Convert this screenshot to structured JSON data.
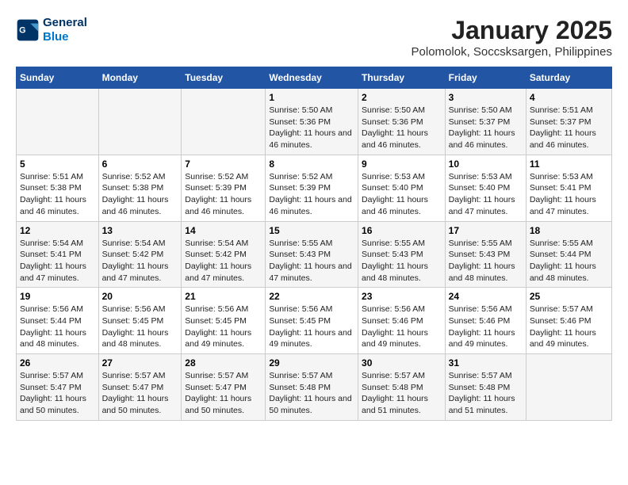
{
  "logo": {
    "line1": "General",
    "line2": "Blue"
  },
  "title": "January 2025",
  "subtitle": "Polomolok, Soccsksargen, Philippines",
  "headers": [
    "Sunday",
    "Monday",
    "Tuesday",
    "Wednesday",
    "Thursday",
    "Friday",
    "Saturday"
  ],
  "weeks": [
    [
      {
        "day": "",
        "sunrise": "",
        "sunset": "",
        "daylight": ""
      },
      {
        "day": "",
        "sunrise": "",
        "sunset": "",
        "daylight": ""
      },
      {
        "day": "",
        "sunrise": "",
        "sunset": "",
        "daylight": ""
      },
      {
        "day": "1",
        "sunrise": "Sunrise: 5:50 AM",
        "sunset": "Sunset: 5:36 PM",
        "daylight": "Daylight: 11 hours and 46 minutes."
      },
      {
        "day": "2",
        "sunrise": "Sunrise: 5:50 AM",
        "sunset": "Sunset: 5:36 PM",
        "daylight": "Daylight: 11 hours and 46 minutes."
      },
      {
        "day": "3",
        "sunrise": "Sunrise: 5:50 AM",
        "sunset": "Sunset: 5:37 PM",
        "daylight": "Daylight: 11 hours and 46 minutes."
      },
      {
        "day": "4",
        "sunrise": "Sunrise: 5:51 AM",
        "sunset": "Sunset: 5:37 PM",
        "daylight": "Daylight: 11 hours and 46 minutes."
      }
    ],
    [
      {
        "day": "5",
        "sunrise": "Sunrise: 5:51 AM",
        "sunset": "Sunset: 5:38 PM",
        "daylight": "Daylight: 11 hours and 46 minutes."
      },
      {
        "day": "6",
        "sunrise": "Sunrise: 5:52 AM",
        "sunset": "Sunset: 5:38 PM",
        "daylight": "Daylight: 11 hours and 46 minutes."
      },
      {
        "day": "7",
        "sunrise": "Sunrise: 5:52 AM",
        "sunset": "Sunset: 5:39 PM",
        "daylight": "Daylight: 11 hours and 46 minutes."
      },
      {
        "day": "8",
        "sunrise": "Sunrise: 5:52 AM",
        "sunset": "Sunset: 5:39 PM",
        "daylight": "Daylight: 11 hours and 46 minutes."
      },
      {
        "day": "9",
        "sunrise": "Sunrise: 5:53 AM",
        "sunset": "Sunset: 5:40 PM",
        "daylight": "Daylight: 11 hours and 46 minutes."
      },
      {
        "day": "10",
        "sunrise": "Sunrise: 5:53 AM",
        "sunset": "Sunset: 5:40 PM",
        "daylight": "Daylight: 11 hours and 47 minutes."
      },
      {
        "day": "11",
        "sunrise": "Sunrise: 5:53 AM",
        "sunset": "Sunset: 5:41 PM",
        "daylight": "Daylight: 11 hours and 47 minutes."
      }
    ],
    [
      {
        "day": "12",
        "sunrise": "Sunrise: 5:54 AM",
        "sunset": "Sunset: 5:41 PM",
        "daylight": "Daylight: 11 hours and 47 minutes."
      },
      {
        "day": "13",
        "sunrise": "Sunrise: 5:54 AM",
        "sunset": "Sunset: 5:42 PM",
        "daylight": "Daylight: 11 hours and 47 minutes."
      },
      {
        "day": "14",
        "sunrise": "Sunrise: 5:54 AM",
        "sunset": "Sunset: 5:42 PM",
        "daylight": "Daylight: 11 hours and 47 minutes."
      },
      {
        "day": "15",
        "sunrise": "Sunrise: 5:55 AM",
        "sunset": "Sunset: 5:43 PM",
        "daylight": "Daylight: 11 hours and 47 minutes."
      },
      {
        "day": "16",
        "sunrise": "Sunrise: 5:55 AM",
        "sunset": "Sunset: 5:43 PM",
        "daylight": "Daylight: 11 hours and 48 minutes."
      },
      {
        "day": "17",
        "sunrise": "Sunrise: 5:55 AM",
        "sunset": "Sunset: 5:43 PM",
        "daylight": "Daylight: 11 hours and 48 minutes."
      },
      {
        "day": "18",
        "sunrise": "Sunrise: 5:55 AM",
        "sunset": "Sunset: 5:44 PM",
        "daylight": "Daylight: 11 hours and 48 minutes."
      }
    ],
    [
      {
        "day": "19",
        "sunrise": "Sunrise: 5:56 AM",
        "sunset": "Sunset: 5:44 PM",
        "daylight": "Daylight: 11 hours and 48 minutes."
      },
      {
        "day": "20",
        "sunrise": "Sunrise: 5:56 AM",
        "sunset": "Sunset: 5:45 PM",
        "daylight": "Daylight: 11 hours and 48 minutes."
      },
      {
        "day": "21",
        "sunrise": "Sunrise: 5:56 AM",
        "sunset": "Sunset: 5:45 PM",
        "daylight": "Daylight: 11 hours and 49 minutes."
      },
      {
        "day": "22",
        "sunrise": "Sunrise: 5:56 AM",
        "sunset": "Sunset: 5:45 PM",
        "daylight": "Daylight: 11 hours and 49 minutes."
      },
      {
        "day": "23",
        "sunrise": "Sunrise: 5:56 AM",
        "sunset": "Sunset: 5:46 PM",
        "daylight": "Daylight: 11 hours and 49 minutes."
      },
      {
        "day": "24",
        "sunrise": "Sunrise: 5:56 AM",
        "sunset": "Sunset: 5:46 PM",
        "daylight": "Daylight: 11 hours and 49 minutes."
      },
      {
        "day": "25",
        "sunrise": "Sunrise: 5:57 AM",
        "sunset": "Sunset: 5:46 PM",
        "daylight": "Daylight: 11 hours and 49 minutes."
      }
    ],
    [
      {
        "day": "26",
        "sunrise": "Sunrise: 5:57 AM",
        "sunset": "Sunset: 5:47 PM",
        "daylight": "Daylight: 11 hours and 50 minutes."
      },
      {
        "day": "27",
        "sunrise": "Sunrise: 5:57 AM",
        "sunset": "Sunset: 5:47 PM",
        "daylight": "Daylight: 11 hours and 50 minutes."
      },
      {
        "day": "28",
        "sunrise": "Sunrise: 5:57 AM",
        "sunset": "Sunset: 5:47 PM",
        "daylight": "Daylight: 11 hours and 50 minutes."
      },
      {
        "day": "29",
        "sunrise": "Sunrise: 5:57 AM",
        "sunset": "Sunset: 5:48 PM",
        "daylight": "Daylight: 11 hours and 50 minutes."
      },
      {
        "day": "30",
        "sunrise": "Sunrise: 5:57 AM",
        "sunset": "Sunset: 5:48 PM",
        "daylight": "Daylight: 11 hours and 51 minutes."
      },
      {
        "day": "31",
        "sunrise": "Sunrise: 5:57 AM",
        "sunset": "Sunset: 5:48 PM",
        "daylight": "Daylight: 11 hours and 51 minutes."
      },
      {
        "day": "",
        "sunrise": "",
        "sunset": "",
        "daylight": ""
      }
    ]
  ]
}
